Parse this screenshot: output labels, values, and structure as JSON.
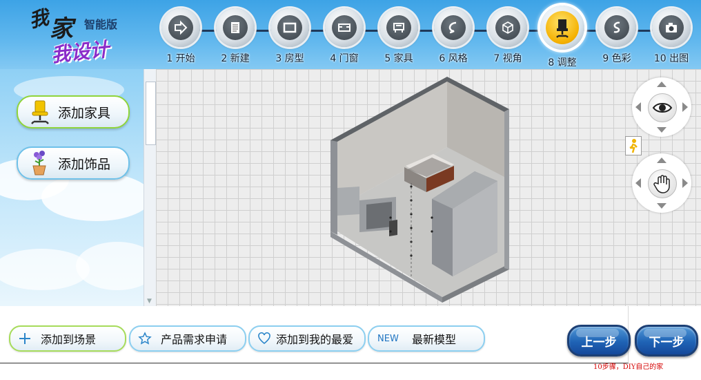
{
  "logo": {
    "line1": "我",
    "line2": "家",
    "line3": "我设计",
    "edition": "智能版"
  },
  "steps": [
    {
      "label": "1 开始",
      "icon": "arrow-right-icon"
    },
    {
      "label": "2 新建",
      "icon": "document-icon"
    },
    {
      "label": "3 房型",
      "icon": "room-icon"
    },
    {
      "label": "4 门窗",
      "icon": "door-window-icon"
    },
    {
      "label": "5 家具",
      "icon": "furniture-icon"
    },
    {
      "label": "6 风格",
      "icon": "style-icon"
    },
    {
      "label": "7 视角",
      "icon": "cube-icon"
    },
    {
      "label": "8 调整",
      "icon": "chair-icon",
      "active": true
    },
    {
      "label": "9 色彩",
      "icon": "color-icon"
    },
    {
      "label": "10 出图",
      "icon": "camera-icon"
    }
  ],
  "sidebar": {
    "add_furniture": "添加家具",
    "add_decoration": "添加饰品"
  },
  "bottom": {
    "add_to_scene": "添加到场景",
    "product_request": "产品需求申请",
    "add_favorite": "添加到我的最爱",
    "new_badge": "NEW",
    "latest_models": "最新模型",
    "prev": "上一步",
    "next": "下一步",
    "tagline": "10步骤，DIY自己的家"
  },
  "colors": {
    "accent_blue": "#1f63b5",
    "active_step": "#f4b000",
    "tagline_red": "#d40000"
  }
}
